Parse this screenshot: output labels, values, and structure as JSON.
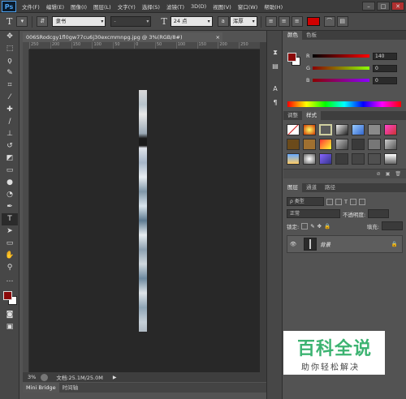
{
  "app": {
    "logo": "Ps"
  },
  "menu": [
    "文件(F)",
    "编辑(E)",
    "图像(I)",
    "图层(L)",
    "文字(Y)",
    "选择(S)",
    "滤镜(T)",
    "3D(D)",
    "视图(V)",
    "窗口(W)",
    "帮助(H)"
  ],
  "window_controls": [
    "–",
    "□",
    "✕"
  ],
  "options_bar": {
    "tool_glyph": "T",
    "font_family": "隶书",
    "font_style": "-",
    "font_size": "24 点",
    "antialias": "浑厚",
    "text_color": "#d00000"
  },
  "document": {
    "tab_title": "006SRodcgy1fl0gw77cu6j30excmmnpg.jpg @ 3%(RGB/8#)",
    "tab_close": "×",
    "ruler_ticks": [
      "250",
      "200",
      "150",
      "100",
      "50",
      "0",
      "50",
      "100",
      "150",
      "200",
      "250"
    ],
    "zoom": "3%",
    "doc_size": "文档:25.1M/25.0M",
    "arrow": "▶"
  },
  "bottom_tabs": [
    "Mini Bridge",
    "时间轴"
  ],
  "color_panel": {
    "tabs": [
      "颜色",
      "色板"
    ],
    "fg_color": "#8b0a0a",
    "channels": [
      {
        "label": "R",
        "value": "140"
      },
      {
        "label": "G",
        "value": "0"
      },
      {
        "label": "B",
        "value": "0"
      }
    ]
  },
  "styles_panel": {
    "tabs": [
      "调整",
      "样式"
    ],
    "footer_icons": [
      "⊘",
      "▣",
      "🗑"
    ]
  },
  "layers_panel": {
    "tabs": [
      "图层",
      "通道",
      "路径"
    ],
    "filter_kind": "ρ 类型",
    "blend_mode": "正常",
    "opacity_label": "不透明度:",
    "lock_label": "锁定:",
    "fill_label": "填充:",
    "layer_name": "背景"
  },
  "watermark": {
    "title": "百科全说",
    "subtitle": "助你轻松解决"
  }
}
